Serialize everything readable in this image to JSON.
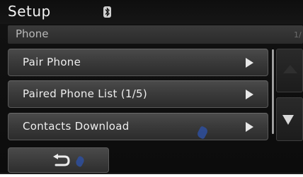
{
  "header": {
    "title": "Setup",
    "status_icon": "bluetooth-icon"
  },
  "subheader": {
    "title": "Phone",
    "page_indicator": "1/"
  },
  "menu": {
    "items": [
      {
        "label": "Pair Phone",
        "icon": "play-arrow-icon"
      },
      {
        "label": "Paired Phone List (1/5)",
        "icon": "play-arrow-icon"
      },
      {
        "label": "Contacts Download",
        "icon": "play-arrow-icon"
      }
    ]
  },
  "scroll": {
    "up_icon": "triangle-up-icon",
    "down_icon": "triangle-down-icon"
  },
  "footer": {
    "back_icon": "return-arrow-icon"
  },
  "colors": {
    "background": "#101010",
    "button": "#3b3b3b",
    "text": "#eeeeee",
    "subtext": "#b8b8b8",
    "accent_glint": "#2e4f9e"
  }
}
